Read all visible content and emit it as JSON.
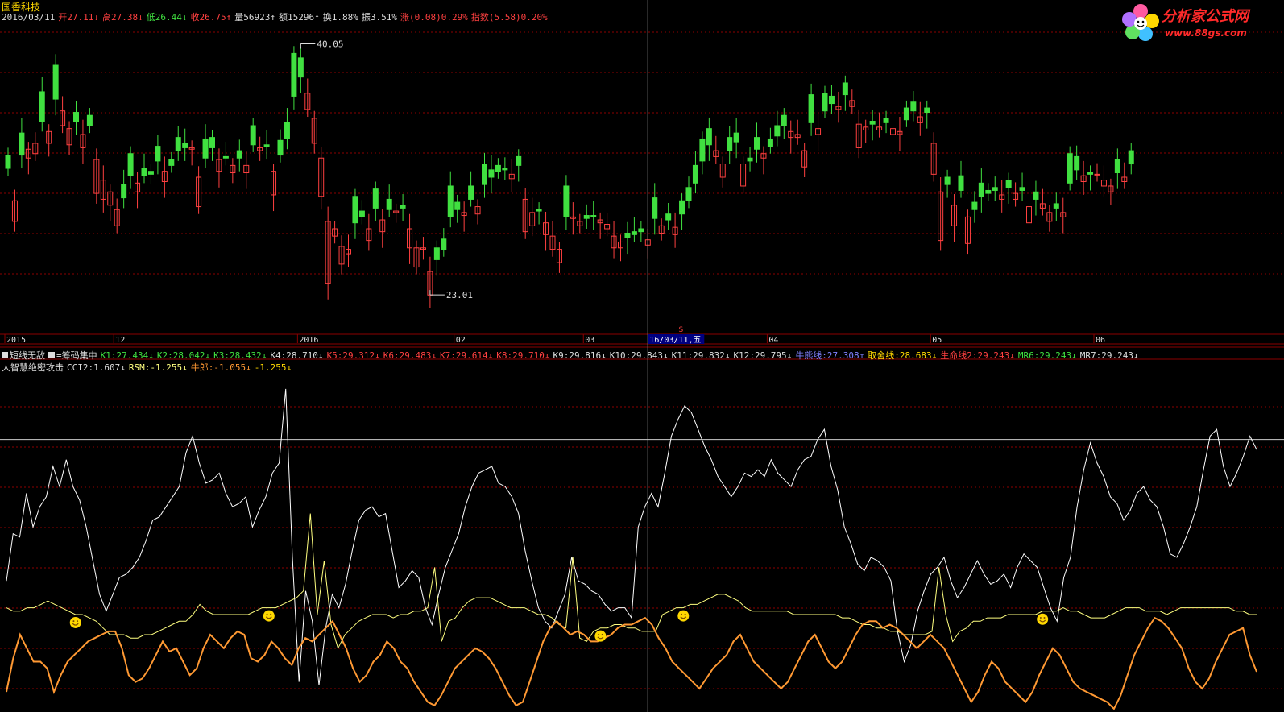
{
  "stock_name": "国香科技",
  "info": [
    {
      "text": "2016/03/11",
      "color": "#dddddd"
    },
    {
      "text": "开27.11↓",
      "color": "#ff4040"
    },
    {
      "text": "高27.38↓",
      "color": "#ff4040"
    },
    {
      "text": "低26.44↓",
      "color": "#40e040"
    },
    {
      "text": "收26.75↑",
      "color": "#ff4040"
    },
    {
      "text": "量56923↑",
      "color": "#dddddd"
    },
    {
      "text": "额15296↑",
      "color": "#dddddd"
    },
    {
      "text": "换1.88%",
      "color": "#dddddd"
    },
    {
      "text": "振3.51%",
      "color": "#dddddd"
    },
    {
      "text": "涨(0.08)0.29%",
      "color": "#ff4040"
    },
    {
      "text": "指数(5.58)0.20%",
      "color": "#ff4040"
    }
  ],
  "indicator_line1": [
    {
      "text": "短线无敌",
      "color": "#dddddd",
      "square": true
    },
    {
      "text": "=筹码集中",
      "color": "#dddddd",
      "square": true
    },
    {
      "text": "K1:27.434↓",
      "color": "#40e040"
    },
    {
      "text": "K2:28.042↓",
      "color": "#40e040"
    },
    {
      "text": "K3:28.432↓",
      "color": "#40e040"
    },
    {
      "text": "K4:28.710↓",
      "color": "#dddddd"
    },
    {
      "text": "K5:29.312↓",
      "color": "#ff4040"
    },
    {
      "text": "K6:29.483↓",
      "color": "#ff4040"
    },
    {
      "text": "K7:29.614↓",
      "color": "#ff4040"
    },
    {
      "text": "K8:29.710↓",
      "color": "#ff4040"
    },
    {
      "text": "K9:29.816↓",
      "color": "#dddddd"
    },
    {
      "text": "K10:29.843↓",
      "color": "#dddddd"
    },
    {
      "text": "K11:29.832↓",
      "color": "#dddddd"
    },
    {
      "text": "K12:29.795↓",
      "color": "#dddddd"
    },
    {
      "text": "牛熊线:27.308↑",
      "color": "#8080ff"
    },
    {
      "text": "取舍线:28.683↓",
      "color": "#ffd800"
    },
    {
      "text": "生命线2:29.243↓",
      "color": "#ff4040"
    },
    {
      "text": "MR6:29.243↓",
      "color": "#40e040"
    },
    {
      "text": "MR7:29.243↓",
      "color": "#dddddd"
    }
  ],
  "indicator_line2": [
    {
      "text": "大智慧绝密攻击",
      "color": "#dddddd"
    },
    {
      "text": "CCI2:1.607↓",
      "color": "#dddddd"
    },
    {
      "text": "RSM:-1.255↓",
      "color": "#ffff80"
    },
    {
      "text": "牛郎:-1.055↓",
      "color": "#ff9933"
    },
    {
      "text": "-1.255↓",
      "color": "#ffd800"
    }
  ],
  "logo": {
    "name": "分析家公式网",
    "url": "www.88gs.com"
  },
  "colors": {
    "up": "#ff4040",
    "down": "#40e040",
    "grid": "#8b0000",
    "cross": "#cccccc",
    "cci": "#ffffff",
    "rsm": "#ffff80",
    "niulang": "#ff9933"
  },
  "chart_data": [
    {
      "type": "candlestick",
      "price_range": [
        20.5,
        41.5
      ],
      "high_label": "40.05",
      "low_label": "23.01",
      "high_value": 40.05,
      "low_value": 23.01,
      "cursor_index": 94,
      "date_ticks": [
        {
          "label": "2015",
          "index": 0
        },
        {
          "label": "12",
          "index": 16
        },
        {
          "label": "2016",
          "index": 43
        },
        {
          "label": "02",
          "index": 66
        },
        {
          "label": "03",
          "index": 85
        },
        {
          "label": "04",
          "index": 112
        },
        {
          "label": "05",
          "index": 136
        },
        {
          "label": "06",
          "index": 160
        }
      ],
      "cursor_date": "16/03/11,五",
      "close": [
        31.6,
        29.4,
        32.5,
        32.9,
        33.3,
        34.8,
        34.1,
        36.3,
        35.5,
        34.3,
        34.8,
        33.9,
        34.5,
        32.2,
        30.8,
        30.0,
        28.8,
        29.6,
        31.1,
        30.6,
        31.1,
        31.2,
        32.1,
        31.4,
        31.8,
        32.8,
        33.0,
        33.0,
        31.0,
        32.3,
        33.0,
        32.2,
        32.3,
        31.8,
        32.3,
        31.8,
        33.2,
        33.0,
        33.1,
        31.4,
        32.5,
        33.6,
        36.5,
        37.8,
        36.7,
        35.0,
        32.3,
        28.0,
        27.5,
        26.3,
        26.1,
        27.9,
        28.3,
        27.5,
        28.9,
        28.1,
        28.8,
        28.7,
        28.9,
        27.5,
        26.2,
        26.2,
        24.6,
        25.4,
        26.1,
        28.3,
        28.8,
        28.6,
        29.5,
        29.0,
        30.5,
        31.0,
        31.4,
        31.5,
        31.2,
        31.8,
        29.5,
        28.6,
        28.7,
        27.9,
        27.0,
        26.1,
        28.3,
        28.3,
        28.0,
        28.2,
        28.3,
        28.1,
        27.8,
        27.0,
        26.6,
        26.9,
        27.1,
        27.3,
        26.75,
        28.2,
        27.7,
        28.1,
        27.6,
        28.5,
        29.4,
        30.6,
        32.1,
        33.2,
        32.8,
        31.9,
        32.8,
        33.4,
        31.9,
        32.1,
        32.9,
        32.6,
        33.1,
        33.8,
        34.5,
        34.1,
        33.9,
        32.8,
        34.7,
        34.3,
        35.5,
        36.0,
        35.8,
        36.6,
        36.2,
        34.6,
        34.4,
        34.6,
        34.4,
        34.7,
        34.3,
        34.1,
        34.9,
        35.5,
        35.1,
        35.4,
        33.3,
        30.0,
        30.5,
        29.1,
        30.1,
        28.3,
        28.8,
        29.7,
        29.9,
        30.1,
        29.8,
        30.3,
        29.9,
        30.1,
        29.0,
        29.5,
        29.2,
        28.6,
        28.9,
        28.6,
        30.6,
        31.5,
        31.1,
        31.2,
        31.2,
        30.8,
        30.4,
        31.3,
        31.0,
        31.9
      ],
      "volatility_note": "",
      "open_offset": [
        0.9,
        -1.4,
        1.5,
        -0.6,
        -0.7,
        2.0,
        -0.8,
        2.3,
        -1.0,
        -1.1,
        0.6,
        -0.9,
        0.7,
        -2.3,
        -1.3,
        -0.9,
        -1.1,
        0.9,
        1.5,
        -0.6,
        0.5,
        0.2,
        1.0,
        -0.7,
        0.4,
        0.9,
        0.3,
        -0.1,
        -2.0,
        1.3,
        0.7,
        -0.8,
        0.1,
        -0.5,
        0.5,
        -0.5,
        1.3,
        -0.2,
        0.1,
        -1.6,
        1.0,
        1.1,
        2.9,
        1.3,
        -1.1,
        -1.7,
        -2.6,
        -4.2,
        -0.5,
        -1.2,
        -0.3,
        1.8,
        0.4,
        -0.8,
        1.3,
        -0.8,
        0.7,
        -0.1,
        0.2,
        -1.3,
        -1.3,
        -0.1,
        -1.6,
        0.8,
        0.7,
        2.1,
        0.5,
        -0.2,
        0.9,
        -0.5,
        1.4,
        0.5,
        0.4,
        0.1,
        -0.3,
        0.6,
        -2.2,
        -0.9,
        0.1,
        -0.8,
        -0.9,
        -0.9,
        2.1,
        -0.1,
        -0.3,
        0.2,
        0.1,
        -0.2,
        -0.3,
        -0.8,
        -0.4,
        0.3,
        0.2,
        0.2,
        -0.36,
        1.4,
        -0.5,
        0.4,
        -0.5,
        0.9,
        0.9,
        1.2,
        1.5,
        1.1,
        -0.4,
        -0.9,
        0.9,
        0.6,
        -1.5,
        0.2,
        0.8,
        -0.3,
        0.5,
        0.7,
        0.7,
        -0.4,
        -0.2,
        -1.1,
        1.9,
        -0.4,
        1.2,
        0.5,
        -0.2,
        0.8,
        -0.4,
        -1.6,
        -0.2,
        0.2,
        -0.2,
        0.3,
        -0.4,
        -0.2,
        0.8,
        0.6,
        -0.4,
        0.3,
        -2.1,
        -3.3,
        0.5,
        -1.4,
        1.0,
        -1.8,
        0.5,
        0.9,
        0.2,
        0.2,
        -0.3,
        0.5,
        -0.4,
        0.2,
        -1.1,
        0.5,
        -0.3,
        -0.6,
        0.3,
        -0.3,
        2.0,
        0.9,
        -0.4,
        0.1,
        0.0,
        -0.4,
        -0.4,
        0.9,
        -0.3,
        0.9
      ]
    },
    {
      "type": "line",
      "series": [
        {
          "name": "CCI2",
          "values": [
            0.62,
            0.48,
            0.49,
            0.36,
            0.46,
            0.4,
            0.37,
            0.28,
            0.34,
            0.26,
            0.34,
            0.38,
            0.46,
            0.56,
            0.66,
            0.71,
            0.66,
            0.61,
            0.6,
            0.58,
            0.55,
            0.5,
            0.44,
            0.43,
            0.4,
            0.37,
            0.34,
            0.24,
            0.19,
            0.27,
            0.33,
            0.32,
            0.3,
            0.36,
            0.4,
            0.39,
            0.37,
            0.46,
            0.41,
            0.37,
            0.3,
            0.27,
            0.05,
            0.55,
            0.92,
            0.65,
            0.74,
            0.93,
            0.76,
            0.66,
            0.7,
            0.63,
            0.53,
            0.44,
            0.41,
            0.4,
            0.43,
            0.42,
            0.53,
            0.64,
            0.62,
            0.59,
            0.61,
            0.7,
            0.75,
            0.66,
            0.58,
            0.53,
            0.48,
            0.4,
            0.34,
            0.3,
            0.29,
            0.28,
            0.33,
            0.34,
            0.37,
            0.42,
            0.53,
            0.62,
            0.7,
            0.74,
            0.76,
            0.71,
            0.66,
            0.55,
            0.62,
            0.63,
            0.65,
            0.66,
            0.69,
            0.71,
            0.7,
            0.7,
            0.73,
            0.46,
            0.4,
            0.36,
            0.4,
            0.3,
            0.19,
            0.14,
            0.1,
            0.12,
            0.17,
            0.22,
            0.26,
            0.31,
            0.34,
            0.37,
            0.34,
            0.3,
            0.31,
            0.29,
            0.31,
            0.26,
            0.3,
            0.32,
            0.34,
            0.29,
            0.26,
            0.25,
            0.2,
            0.17,
            0.28,
            0.35,
            0.46,
            0.51,
            0.57,
            0.59,
            0.55,
            0.56,
            0.58,
            0.62,
            0.77,
            0.86,
            0.81,
            0.71,
            0.65,
            0.6,
            0.58,
            0.55,
            0.62,
            0.67,
            0.64,
            0.6,
            0.56,
            0.6,
            0.63,
            0.62,
            0.6,
            0.64,
            0.58,
            0.54,
            0.56,
            0.58,
            0.64,
            0.7,
            0.74,
            0.61,
            0.55,
            0.4,
            0.29,
            0.21,
            0.27,
            0.31,
            0.37,
            0.39,
            0.44,
            0.41,
            0.36,
            0.34,
            0.38,
            0.4,
            0.46,
            0.54,
            0.55,
            0.51,
            0.46,
            0.4,
            0.29,
            0.19,
            0.17,
            0.28,
            0.34,
            0.3,
            0.25,
            0.19,
            0.23
          ]
        },
        {
          "name": "RSM",
          "values": [
            0.7,
            0.71,
            0.71,
            0.7,
            0.7,
            0.69,
            0.68,
            0.69,
            0.7,
            0.71,
            0.72,
            0.72,
            0.73,
            0.74,
            0.76,
            0.78,
            0.78,
            0.78,
            0.79,
            0.79,
            0.78,
            0.78,
            0.77,
            0.76,
            0.75,
            0.74,
            0.74,
            0.72,
            0.69,
            0.71,
            0.72,
            0.72,
            0.72,
            0.72,
            0.72,
            0.72,
            0.71,
            0.7,
            0.7,
            0.7,
            0.69,
            0.68,
            0.67,
            0.65,
            0.42,
            0.72,
            0.56,
            0.75,
            0.82,
            0.78,
            0.76,
            0.74,
            0.73,
            0.72,
            0.72,
            0.72,
            0.73,
            0.72,
            0.72,
            0.71,
            0.71,
            0.7,
            0.58,
            0.8,
            0.74,
            0.73,
            0.7,
            0.68,
            0.67,
            0.67,
            0.67,
            0.68,
            0.69,
            0.7,
            0.7,
            0.7,
            0.71,
            0.72,
            0.72,
            0.73,
            0.75,
            0.76,
            0.55,
            0.79,
            0.8,
            0.77,
            0.76,
            0.76,
            0.75,
            0.75,
            0.76,
            0.76,
            0.77,
            0.77,
            0.77,
            0.72,
            0.71,
            0.7,
            0.7,
            0.69,
            0.69,
            0.68,
            0.67,
            0.66,
            0.66,
            0.67,
            0.68,
            0.7,
            0.71,
            0.71,
            0.71,
            0.71,
            0.71,
            0.71,
            0.72,
            0.72,
            0.72,
            0.72,
            0.72,
            0.72,
            0.72,
            0.73,
            0.73,
            0.74,
            0.75,
            0.75,
            0.76,
            0.76,
            0.77,
            0.77,
            0.78,
            0.78,
            0.78,
            0.78,
            0.77,
            0.58,
            0.72,
            0.8,
            0.77,
            0.76,
            0.74,
            0.74,
            0.73,
            0.73,
            0.73,
            0.72,
            0.72,
            0.72,
            0.72,
            0.72,
            0.71,
            0.71,
            0.71,
            0.7,
            0.71,
            0.71,
            0.72,
            0.73,
            0.73,
            0.73,
            0.72,
            0.71,
            0.7,
            0.7,
            0.7,
            0.71,
            0.71,
            0.71,
            0.72,
            0.71,
            0.7,
            0.7,
            0.7,
            0.7,
            0.7,
            0.7,
            0.7,
            0.7,
            0.71,
            0.71,
            0.72,
            0.72
          ]
        },
        {
          "name": "牛郎",
          "values": [
            0.95,
            0.85,
            0.78,
            0.82,
            0.86,
            0.86,
            0.88,
            0.95,
            0.9,
            0.86,
            0.84,
            0.82,
            0.8,
            0.79,
            0.78,
            0.77,
            0.77,
            0.82,
            0.9,
            0.92,
            0.91,
            0.88,
            0.84,
            0.8,
            0.83,
            0.82,
            0.86,
            0.9,
            0.88,
            0.82,
            0.78,
            0.8,
            0.82,
            0.79,
            0.77,
            0.78,
            0.85,
            0.86,
            0.84,
            0.8,
            0.82,
            0.85,
            0.87,
            0.82,
            0.79,
            0.8,
            0.78,
            0.76,
            0.74,
            0.78,
            0.82,
            0.88,
            0.92,
            0.9,
            0.86,
            0.84,
            0.8,
            0.82,
            0.86,
            0.88,
            0.92,
            0.95,
            0.98,
            0.99,
            0.96,
            0.92,
            0.88,
            0.86,
            0.84,
            0.82,
            0.83,
            0.85,
            0.88,
            0.92,
            0.96,
            0.99,
            0.98,
            0.92,
            0.86,
            0.8,
            0.76,
            0.74,
            0.76,
            0.78,
            0.77,
            0.78,
            0.8,
            0.8,
            0.79,
            0.78,
            0.76,
            0.75,
            0.75,
            0.74,
            0.73,
            0.75,
            0.79,
            0.82,
            0.86,
            0.88,
            0.9,
            0.92,
            0.94,
            0.91,
            0.88,
            0.86,
            0.84,
            0.8,
            0.78,
            0.82,
            0.86,
            0.88,
            0.9,
            0.92,
            0.94,
            0.92,
            0.88,
            0.84,
            0.8,
            0.78,
            0.82,
            0.86,
            0.88,
            0.86,
            0.82,
            0.78,
            0.75,
            0.74,
            0.74,
            0.76,
            0.75,
            0.76,
            0.78,
            0.8,
            0.82,
            0.8,
            0.78,
            0.8,
            0.82,
            0.86,
            0.9,
            0.94,
            0.98,
            0.95,
            0.9,
            0.86,
            0.88,
            0.92,
            0.94,
            0.96,
            0.98,
            0.95,
            0.9,
            0.86,
            0.82,
            0.84,
            0.88,
            0.92,
            0.94,
            0.95,
            0.96,
            0.97,
            0.98,
            1.0,
            0.96,
            0.9,
            0.84,
            0.8,
            0.76,
            0.73,
            0.74,
            0.76,
            0.79,
            0.82,
            0.88,
            0.92,
            0.94,
            0.91,
            0.86,
            0.82,
            0.78,
            0.77,
            0.76,
            0.84,
            0.89
          ]
        }
      ],
      "smiley_indices": [
        10,
        38,
        86,
        98,
        150
      ],
      "ref_line_fraction": 0.2,
      "cursor_index": 94
    }
  ]
}
